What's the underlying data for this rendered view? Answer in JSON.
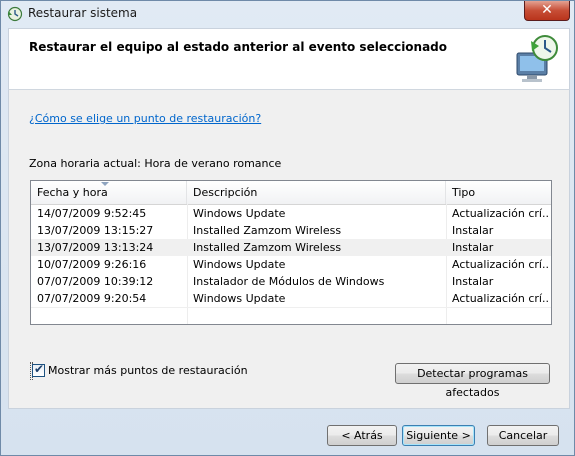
{
  "window": {
    "title": "Restaurar sistema",
    "close_label": "✕"
  },
  "header": {
    "title": "Restaurar el equipo al estado anterior al evento seleccionado",
    "icon": "system-restore-icon"
  },
  "help_link": "¿Cómo se elige un punto de restauración?",
  "timezone": "Zona horaria actual: Hora de verano romance",
  "table": {
    "columns": [
      "Fecha y hora",
      "Descripción",
      "Tipo"
    ],
    "rows": [
      {
        "date": "14/07/2009 9:52:45",
        "description": "Windows Update",
        "type": "Actualización crí..."
      },
      {
        "date": "13/07/2009 13:15:27",
        "description": "Installed Zamzom Wireless",
        "type": "Instalar"
      },
      {
        "date": "13/07/2009 13:13:24",
        "description": "Installed Zamzom Wireless",
        "type": "Instalar"
      },
      {
        "date": "10/07/2009 9:26:16",
        "description": "Windows Update",
        "type": "Actualización crí..."
      },
      {
        "date": "07/07/2009 10:39:12",
        "description": "Instalador de Módulos de Windows",
        "type": "Instalar"
      },
      {
        "date": "07/07/2009 9:20:54",
        "description": "Windows Update",
        "type": "Actualización crí..."
      }
    ]
  },
  "show_more": {
    "label": "Mostrar más puntos de restauración",
    "checked": true
  },
  "buttons": {
    "detect": "Detectar programas afectados",
    "back": "< Atrás",
    "next": "Siguiente >",
    "cancel": "Cancelar"
  }
}
